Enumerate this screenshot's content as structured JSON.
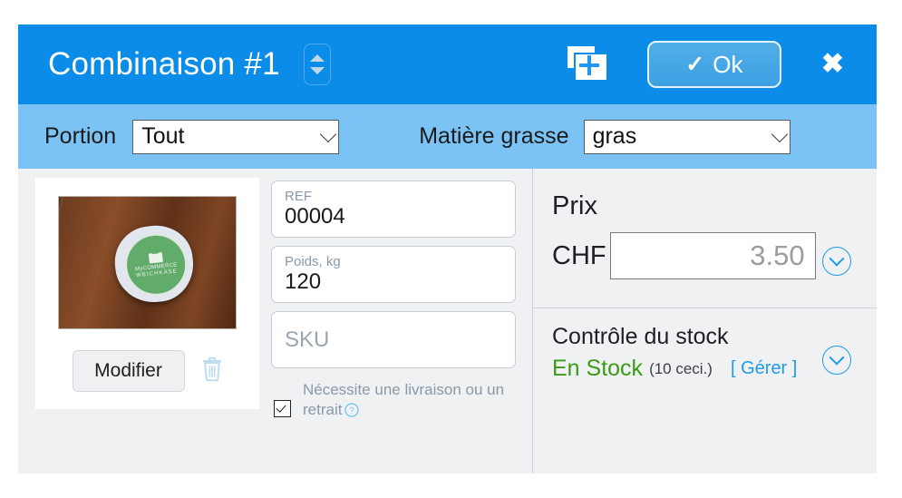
{
  "titlebar": {
    "title": "Combinaison #1",
    "spinner_name": "combination-stepper",
    "duplicate_icon": "duplicate-add-icon",
    "ok_label": "Ok",
    "ok_check": "✓",
    "close_label": "✖"
  },
  "toolbar": {
    "portion_label": "Portion",
    "portion_value": "Tout",
    "fat_label": "Matière grasse",
    "fat_value": "gras"
  },
  "image_panel": {
    "photo_alt": "product-photo-soft-cheese",
    "label_brand": "MyCOMMERCE",
    "label_product": "WEICHKÄSE",
    "modify_label": "Modifier",
    "delete_icon": "trash-icon"
  },
  "fields": {
    "ref_label": "REF",
    "ref_value": "00004",
    "weight_label": "Poids, kg",
    "weight_value": "120",
    "sku_placeholder": "SKU",
    "sku_value": "",
    "shipping_checkbox_label": "Nécessite une livraison ou un retrait",
    "help_icon": "help-question-icon"
  },
  "price": {
    "section_title": "Prix",
    "currency": "CHF",
    "amount": "3.50",
    "expand_icon": "chevron-down-circle-icon"
  },
  "stock": {
    "section_title": "Contrôle du stock",
    "status": "En Stock",
    "count": "(10 ceci.)",
    "manage_label": "[ Gérer ]",
    "expand_icon": "chevron-down-circle-icon"
  },
  "colors": {
    "titlebar_blue": "#0b8ce8",
    "toolbar_blue": "#7cc3f5",
    "content_grey": "#f0f1f3",
    "accent_link": "#1e9ae8",
    "stock_green": "#3a9b16"
  }
}
